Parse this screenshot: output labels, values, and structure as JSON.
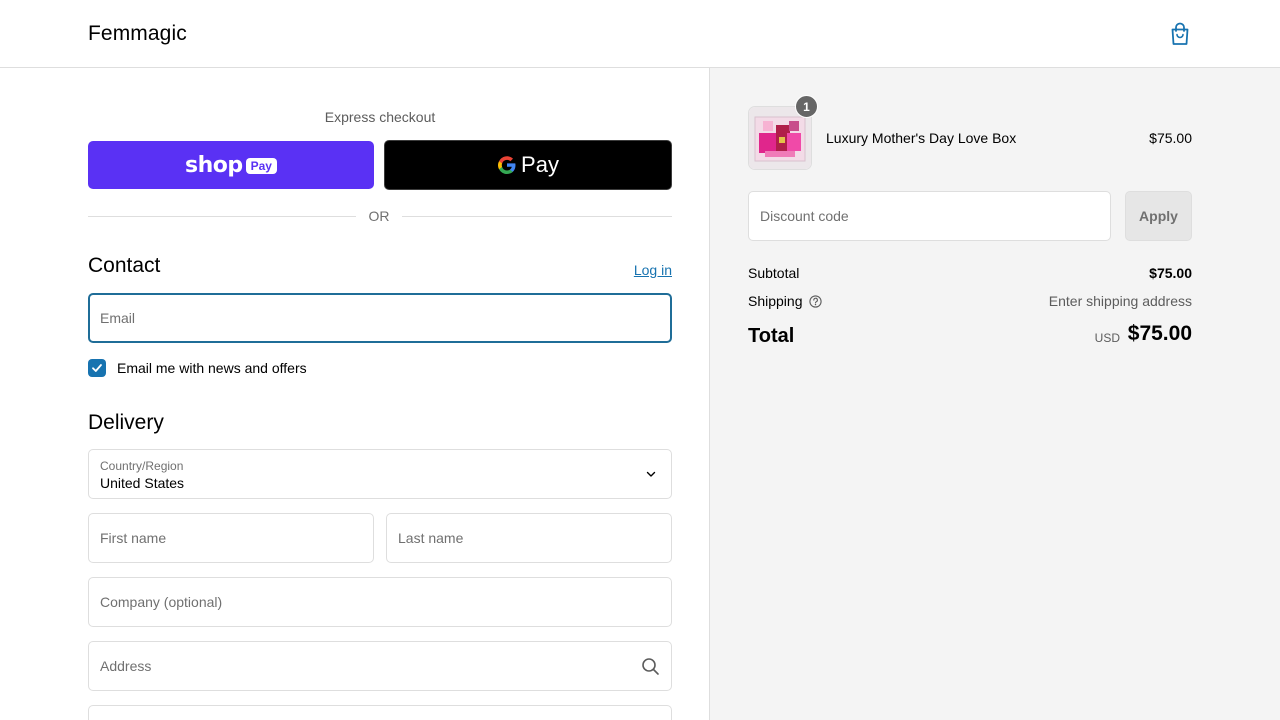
{
  "header": {
    "brand": "Femmagic",
    "cart_icon": "shopping-bag-icon"
  },
  "express": {
    "title": "Express checkout",
    "shop_pay_word": "shop",
    "shop_pay_badge": "Pay",
    "google_pay_g": "G",
    "google_pay_word": "Pay",
    "or_text": "OR"
  },
  "contact": {
    "title": "Contact",
    "login_label": "Log in",
    "email_placeholder": "Email",
    "newsletter_label": "Email me with news and offers",
    "newsletter_checked": true
  },
  "delivery": {
    "title": "Delivery",
    "country_label": "Country/Region",
    "country_value": "United States",
    "first_name_placeholder": "First name",
    "last_name_placeholder": "Last name",
    "company_placeholder": "Company (optional)",
    "address_placeholder": "Address"
  },
  "summary": {
    "item": {
      "name": "Luxury Mother's Day Love Box",
      "price": "$75.00",
      "quantity": "1"
    },
    "discount_placeholder": "Discount code",
    "apply_label": "Apply",
    "subtotal_label": "Subtotal",
    "subtotal_value": "$75.00",
    "shipping_label": "Shipping",
    "shipping_value": "Enter shipping address",
    "total_label": "Total",
    "total_currency": "USD",
    "total_value": "$75.00"
  },
  "colors": {
    "accent": "#1773b0",
    "shop_pay": "#5a31f4",
    "sidebar_bg": "#f4f4f4"
  }
}
